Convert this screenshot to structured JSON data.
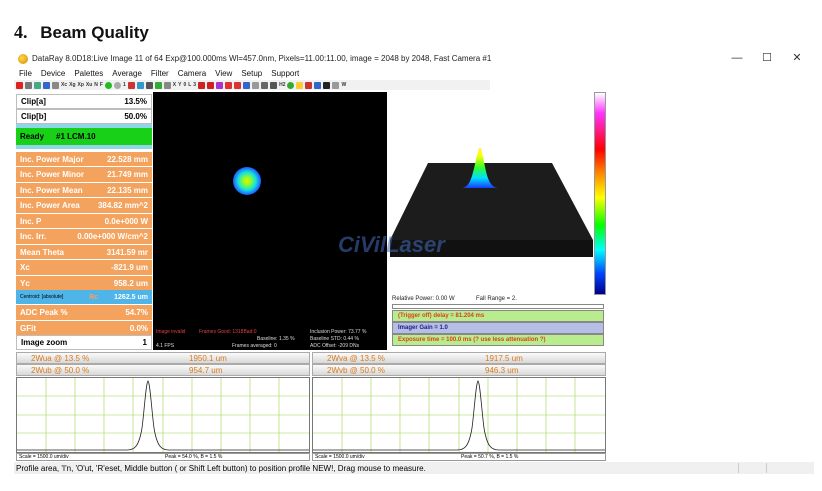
{
  "heading": {
    "number": "4.",
    "text": "Beam Quality"
  },
  "window": {
    "title": "DataRay 8.0D18:Live Image 11 of 64   Exp@100.000ms   Wl=457.0nm, Pixels=11.00:11.00, image = 2048 by 2048, Fast   Camera #1",
    "minimize": "—",
    "maximize": "☐",
    "close": "✕"
  },
  "menu": [
    "File",
    "Device",
    "Palettes",
    "Average",
    "Filter",
    "Camera",
    "View",
    "Setup",
    "Support"
  ],
  "toolbar_text": [
    "Xc",
    "Xg",
    "Xp",
    "Xu",
    "N",
    "F",
    "1",
    "X",
    "Y",
    "0",
    "L",
    "3",
    "H2",
    "W"
  ],
  "left_panel": {
    "clip_a": {
      "label": "Clip[a]",
      "value": "13.5%"
    },
    "clip_b": {
      "label": "Clip[b]",
      "value": "50.0%"
    },
    "status": {
      "label": "Ready",
      "value": "#1 LCM.10"
    },
    "metrics": [
      {
        "label": "Inc. Power Major",
        "value": "22.528 mm"
      },
      {
        "label": "Inc. Power Minor",
        "value": "21.749 mm"
      },
      {
        "label": "Inc. Power Mean",
        "value": "22.135 mm"
      },
      {
        "label": "Inc. Power Area",
        "value": "384.82 mm^2"
      },
      {
        "label": "Inc. P",
        "value": "0.0e+000 W"
      },
      {
        "label": "Inc. Irr.",
        "value": "0.00e+000 W/cm^2"
      },
      {
        "label": "Mean Theta",
        "value": "3141.59 mr"
      },
      {
        "label": "Xc",
        "value": "-821.9 um"
      },
      {
        "label": "Yc",
        "value": "958.2 um"
      }
    ],
    "centroid": {
      "label": "Centroid: [absolute]",
      "rc": "Rc",
      "value": "1262.5 um"
    },
    "adc_peak": {
      "label": "ADC Peak %",
      "value": "54.7%"
    },
    "gfit": {
      "label": "GFit",
      "value": "0.0%"
    },
    "image_zoom": {
      "label": "Image zoom",
      "value": "1"
    }
  },
  "image_info": {
    "invalid": "Image invalid",
    "frames_good": "Frames Good: 1318Bad:0",
    "baseline": "Baseline: 1.35 %",
    "frames_avg": "Frames averaged: 0",
    "fps": "4.1 FPS",
    "inclusion": "Inclusion Power: 73.77 %",
    "baseline_std": "Baseline STD:  0.44 %",
    "adc_offset": "ADC Offset:  -209 DNs"
  },
  "watermark": "CiVilLaser",
  "plot_panel": {
    "relative_power": "Relative Power: 0.00 W",
    "fall_range": "Fall Range = 2.",
    "trigger": "(Trigger off) delay = 81.204 ms",
    "imager_gain": "Imager Gain = 1.0",
    "exposure": "Exposure time = 100.0 ms   (?  use less attenuation ?)"
  },
  "profiles": {
    "left": {
      "row1_label": "2Wua @ 13.5 %",
      "row1_value": "1950.1 um",
      "row2_label": "2Wub @ 50.0 %",
      "row2_value": "954.7 um",
      "scale": "Scale = 1500.0 um/div",
      "peak": "Peak = 54.0 %, B = 1.5 %"
    },
    "right": {
      "row1_label": "2Wva @ 13.5 %",
      "row1_value": "1917.5 um",
      "row2_label": "2Wvb @ 50.0 %",
      "row2_value": "946.3 um",
      "scale": "Scale = 1500.0 um/div",
      "peak": "Peak = 50.7 %, B = 1.5 %"
    }
  },
  "status_bar": "Profile area, 'I'n, 'O'ut, 'R'eset, Middle button ( or Shift Left button) to position profile NEW!, Drag mouse to measure.",
  "colors": {
    "orange_row": "#f4a35e",
    "green_status": "#17d017",
    "profile_grid": "#9fd64a"
  }
}
